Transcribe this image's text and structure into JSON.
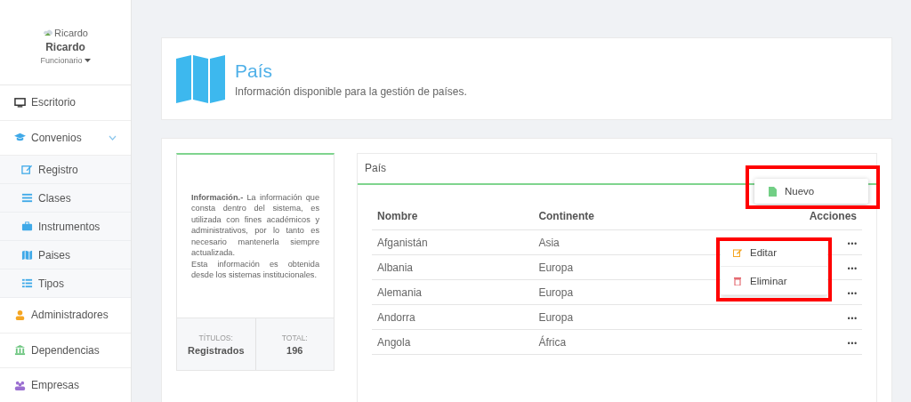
{
  "sidebar": {
    "profile": {
      "avatar_alt": "Ricardo",
      "name": "Ricardo",
      "role": "Funcionario"
    },
    "items": [
      {
        "label": "Escritorio",
        "kind": "item"
      },
      {
        "label": "Convenios",
        "kind": "group",
        "expanded": true
      },
      {
        "label": "Registro",
        "kind": "subitem"
      },
      {
        "label": "Clases",
        "kind": "subitem"
      },
      {
        "label": "Instrumentos",
        "kind": "subitem"
      },
      {
        "label": "Paises",
        "kind": "subitem"
      },
      {
        "label": "Tipos",
        "kind": "subitem"
      },
      {
        "label": "Administradores",
        "kind": "item"
      },
      {
        "label": "Dependencias",
        "kind": "item"
      },
      {
        "label": "Empresas",
        "kind": "item"
      }
    ]
  },
  "header": {
    "title": "País",
    "subtitle": "Información disponible para la gestión de países."
  },
  "info": {
    "text": "**Información.-** La información que consta dentro del sistema, es utilizada con fines académicos y administrativos, por lo tanto es necesario mantenerla siempre actualizada.\nEsta información es obtenida desde los sistemas institucionales.",
    "stats": [
      {
        "label": "TÍTULOS:",
        "value": "Registrados"
      },
      {
        "label": "TOTAL:",
        "value": "196"
      }
    ]
  },
  "table": {
    "title": "País",
    "columns": [
      "Nombre",
      "Continente",
      "Acciones"
    ],
    "new_menu": {
      "label": "Nuevo"
    },
    "rows": [
      {
        "name": "Afganistán",
        "continent": "Asia",
        "actions": "•••",
        "menu": [
          "Editar",
          "Eliminar"
        ]
      },
      {
        "name": "Albania",
        "continent": "Europa",
        "actions": "•••"
      },
      {
        "name": "Alemania",
        "continent": "Europa",
        "actions": "•••"
      },
      {
        "name": "Andorra",
        "continent": "Europa",
        "actions": "•••"
      },
      {
        "name": "Angola",
        "continent": "África",
        "actions": "•••"
      }
    ]
  }
}
